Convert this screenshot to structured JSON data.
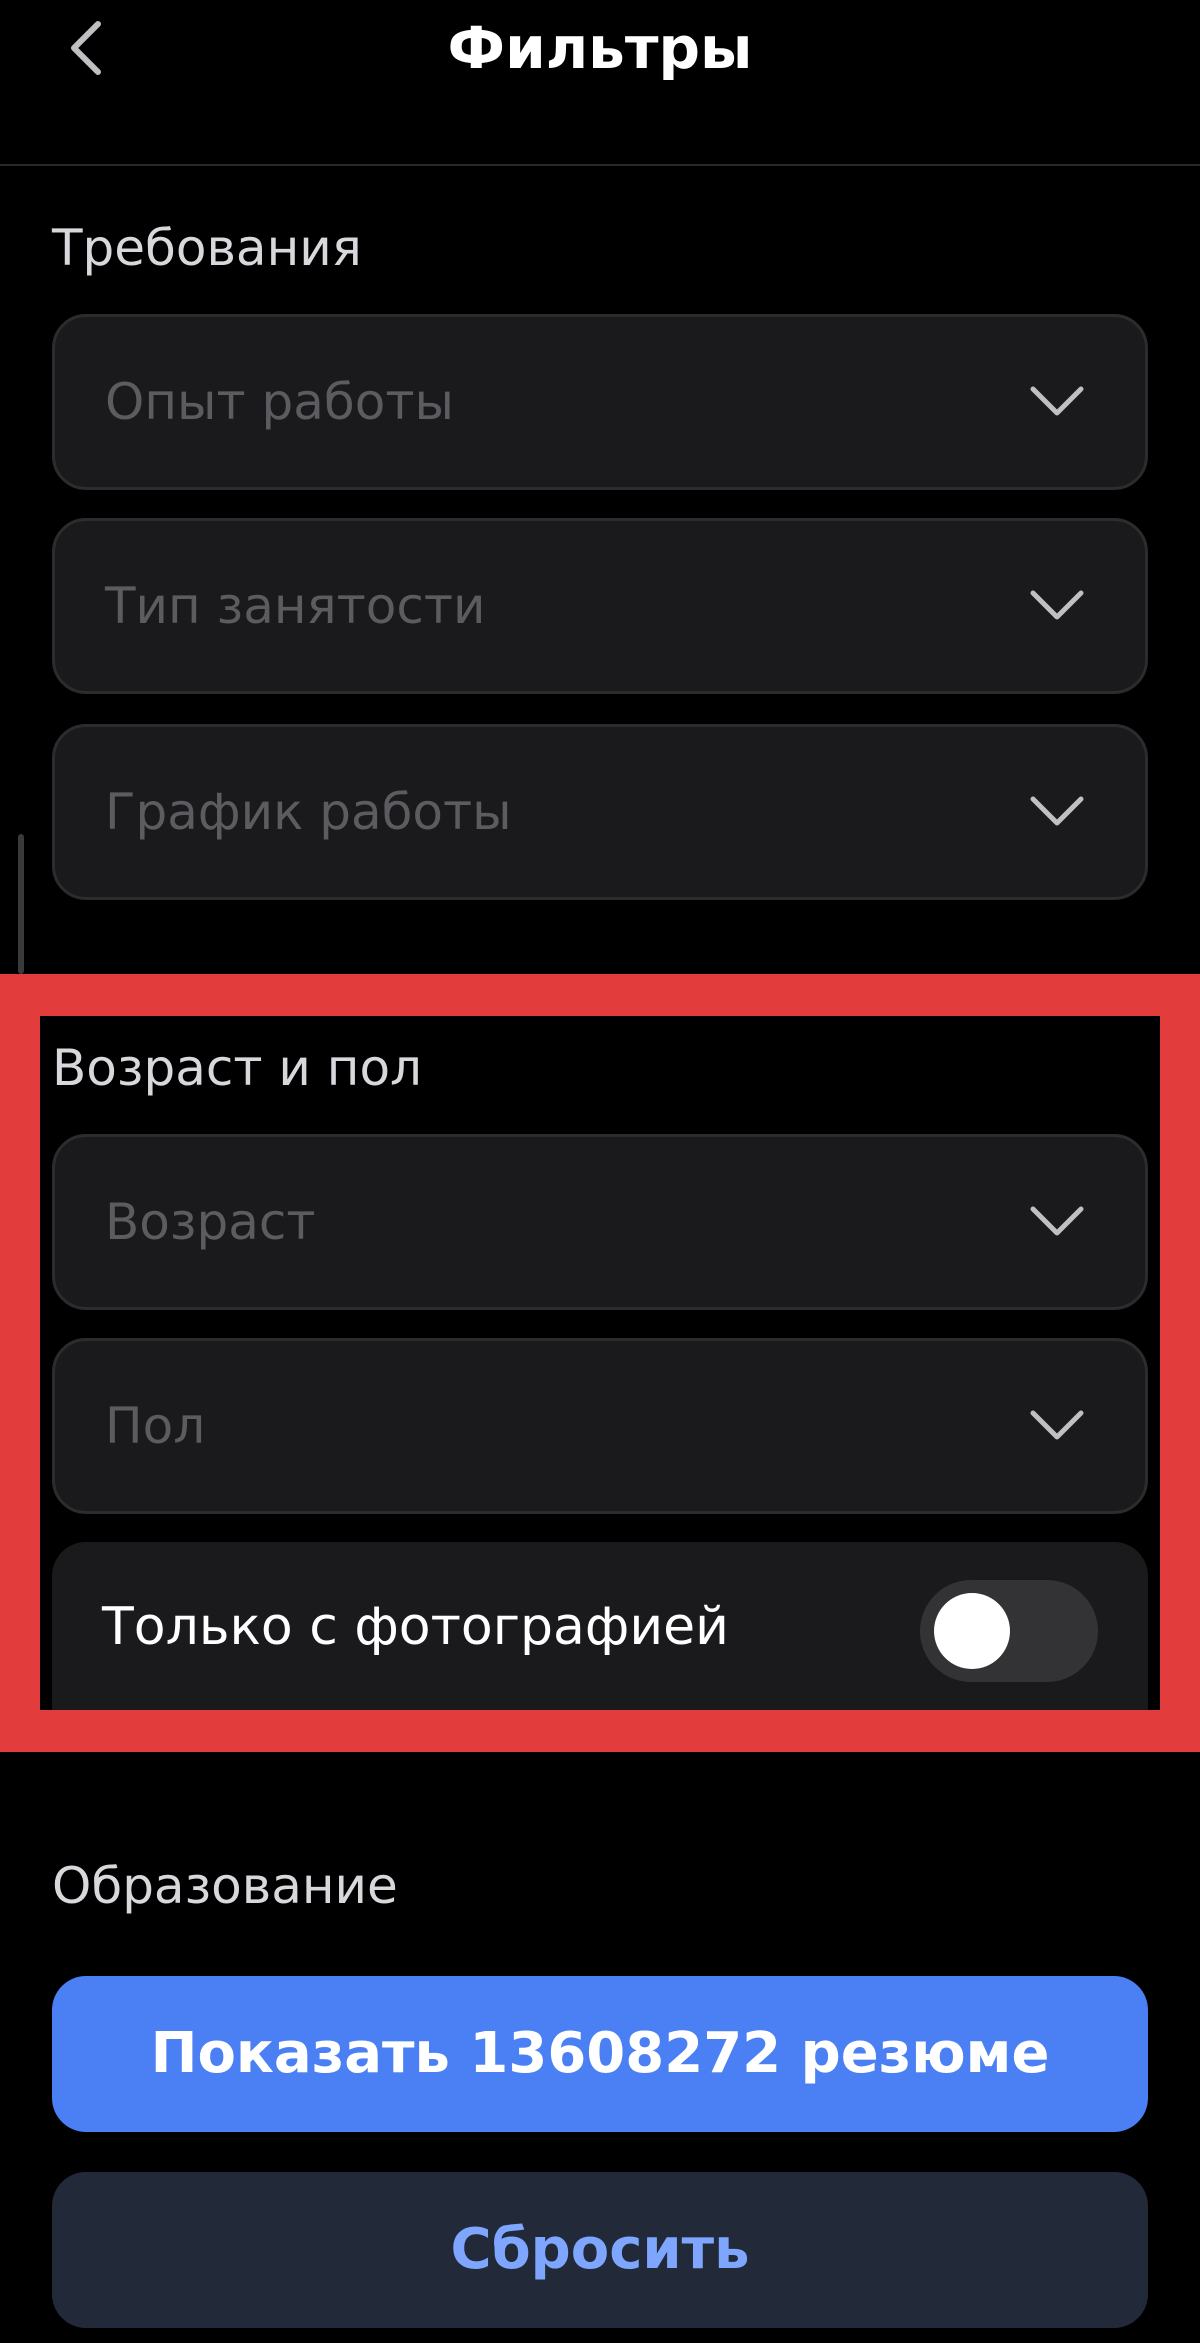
{
  "header": {
    "title": "Фильтры",
    "back_icon": "chevron-left-icon"
  },
  "sections": {
    "requirements": {
      "title": "Требования",
      "dropdowns": [
        {
          "placeholder": "Опыт работы",
          "icon": "chevron-down-icon"
        },
        {
          "placeholder": "Тип занятости",
          "icon": "chevron-down-icon"
        },
        {
          "placeholder": "График работы",
          "icon": "chevron-down-icon"
        }
      ]
    },
    "age_gender": {
      "title": "Возраст и пол",
      "dropdowns": [
        {
          "placeholder": "Возраст",
          "icon": "chevron-down-icon"
        },
        {
          "placeholder": "Пол",
          "icon": "chevron-down-icon"
        }
      ],
      "photo_toggle": {
        "label": "Только с фотографией",
        "checked": false
      }
    },
    "education": {
      "title": "Образование"
    }
  },
  "actions": {
    "show_label": "Показать 13608272 резюме",
    "reset_label": "Сбросить"
  },
  "colors": {
    "background": "#000000",
    "accent": "#4a80f4",
    "highlight": "#e23c3c",
    "secondary_button": "#222a3a",
    "secondary_text": "#7ea6ff"
  }
}
